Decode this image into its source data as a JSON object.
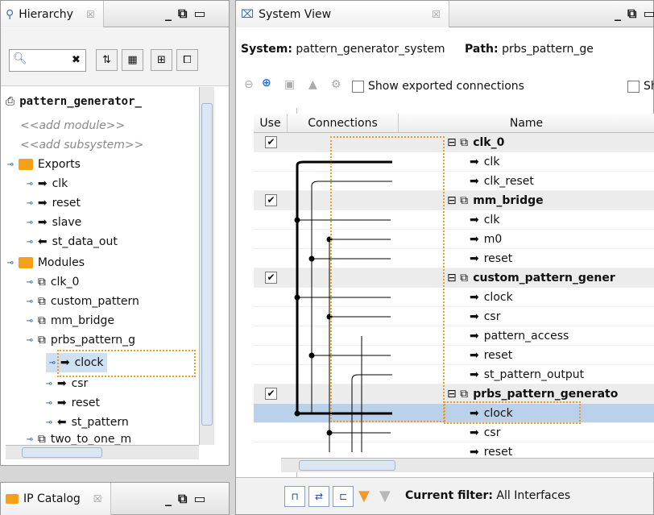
{
  "hierarchy_panel": {
    "tab_title": "Hierarchy",
    "root": "pattern_generator_",
    "add_module": "<<add module>>",
    "add_subsystem": "<<add subsystem>>",
    "exports_label": "Exports",
    "exports": [
      "clk",
      "reset",
      "slave",
      "st_data_out"
    ],
    "modules_label": "Modules",
    "modules": [
      "clk_0",
      "custom_pattern",
      "mm_bridge",
      "prbs_pattern_g"
    ],
    "prbs_children": [
      "clock",
      "csr",
      "reset",
      "st_pattern"
    ],
    "tail_partial": "two_to_one_m"
  },
  "ip_catalog": {
    "tab_title": "IP Catalog"
  },
  "system_view": {
    "tab_title": "System View",
    "system_label": "System:",
    "system_value": "pattern_generator_system",
    "path_label": "Path:",
    "path_value": "prbs_pattern_ge",
    "show_exported": "Show exported connections",
    "show_partial": "Sh",
    "columns": {
      "use": "Use",
      "connections": "Connections",
      "name": "Name"
    },
    "rows": [
      {
        "name": "clk_0",
        "type": "module",
        "checked": true
      },
      {
        "name": "clk",
        "type": "port"
      },
      {
        "name": "clk_reset",
        "type": "port"
      },
      {
        "name": "mm_bridge",
        "type": "module",
        "checked": true
      },
      {
        "name": "clk",
        "type": "port"
      },
      {
        "name": "m0",
        "type": "port"
      },
      {
        "name": "reset",
        "type": "port"
      },
      {
        "name": "custom_pattern_gener",
        "type": "module",
        "checked": true
      },
      {
        "name": "clock",
        "type": "port"
      },
      {
        "name": "csr",
        "type": "port"
      },
      {
        "name": "pattern_access",
        "type": "port"
      },
      {
        "name": "reset",
        "type": "port"
      },
      {
        "name": "st_pattern_output",
        "type": "port"
      },
      {
        "name": "prbs_pattern_generato",
        "type": "module",
        "checked": true
      },
      {
        "name": "clock",
        "type": "port",
        "selected": true
      },
      {
        "name": "csr",
        "type": "port"
      },
      {
        "name": "reset",
        "type": "port"
      }
    ],
    "filter_label": "Current filter:",
    "filter_value": "All Interfaces"
  },
  "colors": {
    "accent_orange": "#f09a2e",
    "selection_blue": "#b9d1ea",
    "folder": "#f4a019"
  }
}
